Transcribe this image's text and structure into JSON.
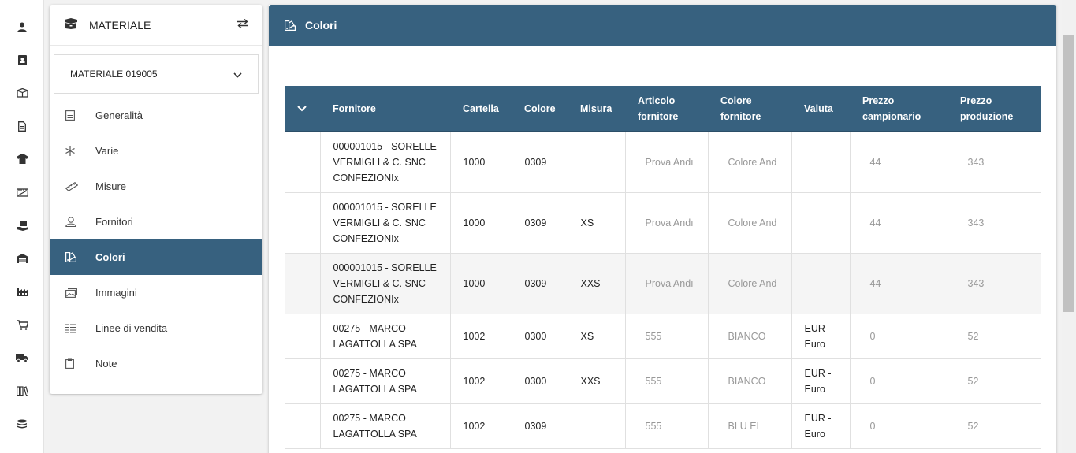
{
  "rail": {
    "icons": [
      "user-icon",
      "contact-card-icon",
      "box-open-icon",
      "document-icon",
      "tshirt-icon",
      "ruler-panel-icon",
      "box-hand-icon",
      "warehouse-icon",
      "factory-icon",
      "cart-icon",
      "truck-icon",
      "books-icon",
      "coins-icon",
      "more-icon"
    ]
  },
  "materiale": {
    "title": "MATERIALE",
    "selected": "MATERIALE 019005",
    "nav": [
      {
        "label": "Generalità",
        "icon": "list-icon"
      },
      {
        "label": "Varie",
        "icon": "asterisk-icon"
      },
      {
        "label": "Misure",
        "icon": "ruler-icon"
      },
      {
        "label": "Fornitori",
        "icon": "supplier-icon"
      },
      {
        "label": "Colori",
        "icon": "palette-icon"
      },
      {
        "label": "Immagini",
        "icon": "images-icon"
      },
      {
        "label": "Linee di vendita",
        "icon": "lines-icon"
      },
      {
        "label": "Note",
        "icon": "clipboard-icon"
      }
    ]
  },
  "main": {
    "title": "Colori"
  },
  "table": {
    "headers": {
      "fornitore": "Fornitore",
      "cartella": "Cartella",
      "colore": "Colore",
      "misura": "Misura",
      "articolo": "Articolo fornitore",
      "colore_fornitore": "Colore fornitore",
      "valuta": "Valuta",
      "prezzo_camp": "Prezzo campionario",
      "prezzo_prod": "Prezzo produzione"
    },
    "rows": [
      {
        "fornitore": "000001015 - SORELLE VERMIGLI & C. SNC CONFEZIONIx",
        "cartella": "1000",
        "colore": "0309",
        "misura": "",
        "articolo": "Prova Andı",
        "colore_fornitore": "Colore And",
        "valuta": "",
        "prezzo_camp": "44",
        "prezzo_prod": "343"
      },
      {
        "fornitore": "000001015 - SORELLE VERMIGLI & C. SNC CONFEZIONIx",
        "cartella": "1000",
        "colore": "0309",
        "misura": "XS",
        "articolo": "Prova Andı",
        "colore_fornitore": "Colore And",
        "valuta": "",
        "prezzo_camp": "44",
        "prezzo_prod": "343"
      },
      {
        "fornitore": "000001015 - SORELLE VERMIGLI & C. SNC CONFEZIONIx",
        "cartella": "1000",
        "colore": "0309",
        "misura": "XXS",
        "articolo": "Prova Andı",
        "colore_fornitore": "Colore And",
        "valuta": "",
        "prezzo_camp": "44",
        "prezzo_prod": "343"
      },
      {
        "fornitore": "00275 - MARCO LAGATTOLLA SPA",
        "cartella": "1002",
        "colore": "0300",
        "misura": "XS",
        "articolo": "555",
        "colore_fornitore": "BIANCO",
        "valuta": "EUR - Euro",
        "prezzo_camp": "0",
        "prezzo_prod": "52"
      },
      {
        "fornitore": "00275 - MARCO LAGATTOLLA SPA",
        "cartella": "1002",
        "colore": "0300",
        "misura": "XXS",
        "articolo": "555",
        "colore_fornitore": "BIANCO",
        "valuta": "EUR - Euro",
        "prezzo_camp": "0",
        "prezzo_prod": "52"
      },
      {
        "fornitore": "00275 - MARCO LAGATTOLLA SPA",
        "cartella": "1002",
        "colore": "0309",
        "misura": "",
        "articolo": "555",
        "colore_fornitore": "BLU EL",
        "valuta": "EUR - Euro",
        "prezzo_camp": "0",
        "prezzo_prod": "52"
      }
    ]
  },
  "colors": {
    "accent": "#37617f"
  }
}
